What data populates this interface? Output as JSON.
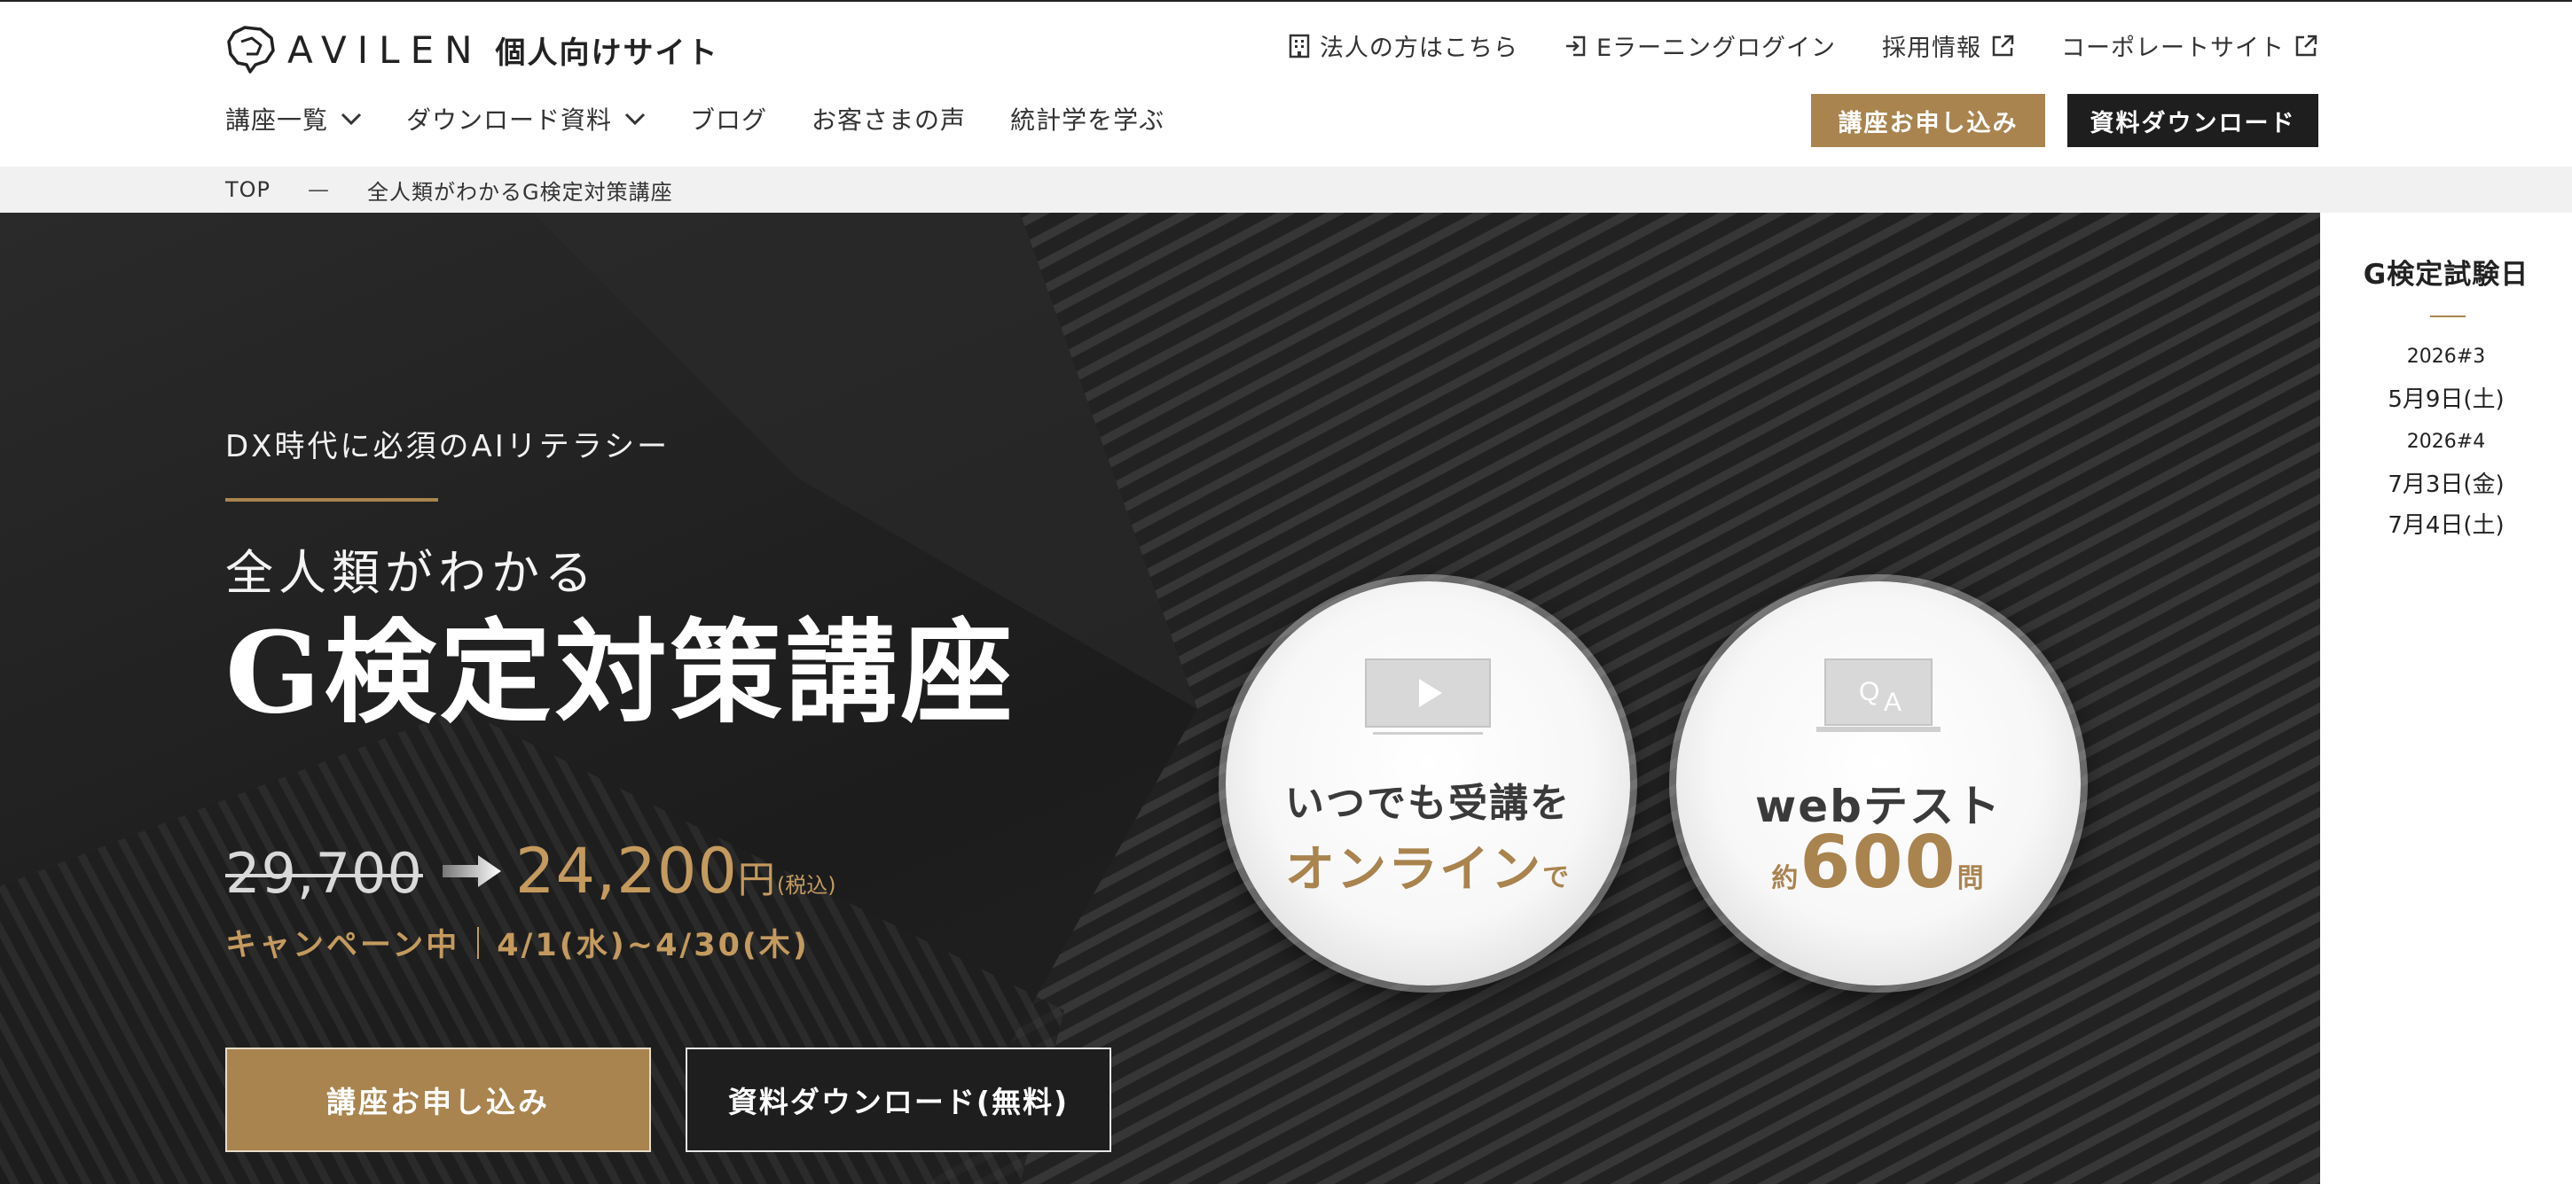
{
  "header": {
    "brand_name": "AVILEN",
    "brand_sub": "個人向けサイト",
    "util_links": [
      {
        "label": "法人の方はこちら",
        "icon": "building-icon"
      },
      {
        "label": "Eラーニングログイン",
        "icon": "login-icon"
      },
      {
        "label": "採用情報",
        "icon": "external-link-icon"
      },
      {
        "label": "コーポレートサイト",
        "icon": "external-link-icon"
      }
    ],
    "nav": [
      {
        "label": "講座一覧",
        "dropdown": true
      },
      {
        "label": "ダウンロード資料",
        "dropdown": true
      },
      {
        "label": "ブログ",
        "dropdown": false
      },
      {
        "label": "お客さまの声",
        "dropdown": false
      },
      {
        "label": "統計学を学ぶ",
        "dropdown": false
      }
    ],
    "apply_label": "講座お申し込み",
    "download_label": "資料ダウンロード"
  },
  "breadcrumb": {
    "home": "TOP",
    "separator": "—",
    "current": "全人類がわかるG検定対策講座"
  },
  "hero": {
    "eyebrow": "DX時代に必須のAIリテラシー",
    "subtitle": "全人類がわかる",
    "title": "G検定対策講座",
    "price_old": "29,700",
    "price_new": "24,200",
    "price_unit": "円",
    "price_tax": "(税込)",
    "campaign_label": "キャンペーン中",
    "campaign_period": "4/1(水)~4/30(木)",
    "apply_label": "講座お申し込み",
    "download_label": "資料ダウンロード(無料)",
    "features": [
      {
        "line1": "いつでも受講を",
        "line2_main": "オンライン",
        "line2_suffix": "で",
        "icon": "video-play-icon"
      },
      {
        "line1": "webテスト",
        "line2_prefix": "約",
        "line2_main": "600",
        "line2_suffix": "問",
        "icon": "qa-icon"
      }
    ]
  },
  "exam": {
    "title": "G検定試験日",
    "rounds": [
      {
        "label": "2026#3",
        "dates": [
          "5月9日(土)"
        ]
      },
      {
        "label": "2026#4",
        "dates": [
          "7月3日(金)",
          "7月4日(土)"
        ]
      }
    ]
  },
  "colors": {
    "accent_gold": "#a9844f",
    "price_gold": "#c49a5e",
    "dark": "#1e1e1e"
  }
}
